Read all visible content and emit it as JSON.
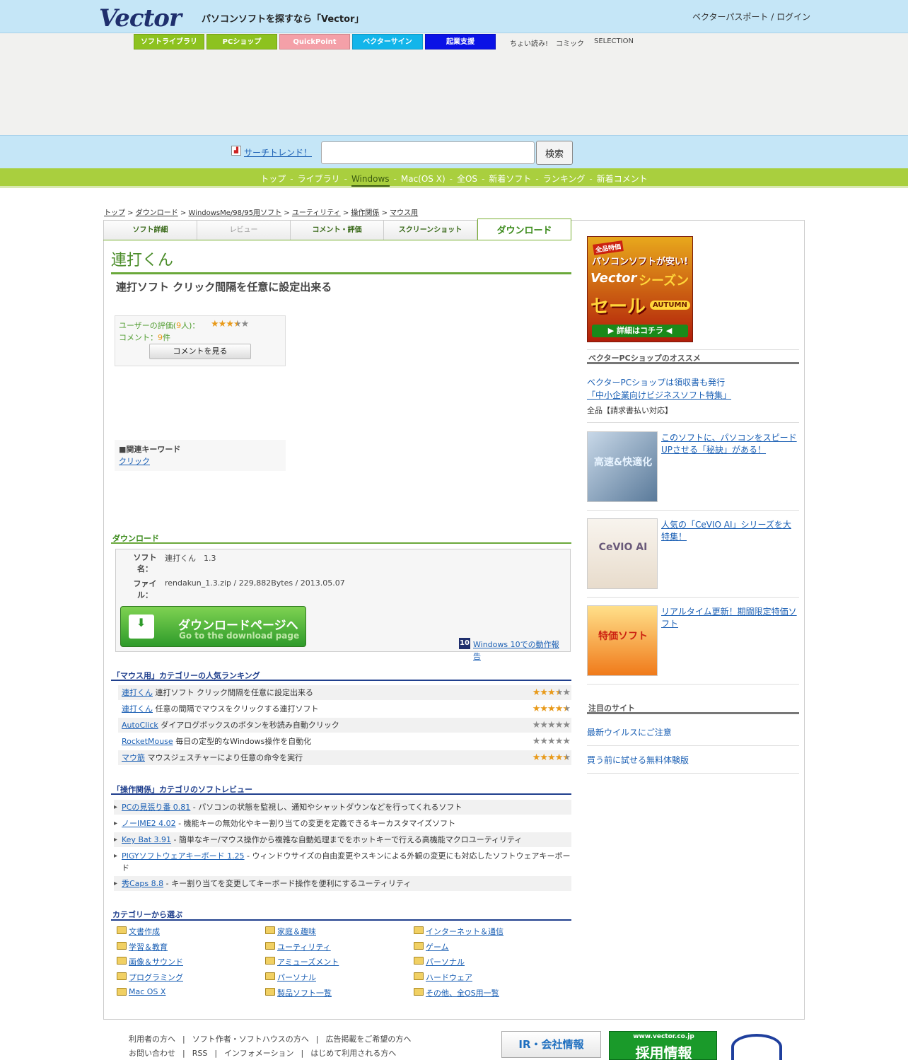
{
  "header": {
    "logo": "Vector",
    "tagline": "パソコンソフトを探すなら「Vector」",
    "login": "ベクターパスポート / ログイン"
  },
  "services": {
    "buttons": [
      {
        "label": "ソフトライブラリ",
        "color": "#8dc21f"
      },
      {
        "label": "PCショップ",
        "color": "#8dc21f"
      },
      {
        "label": "QuickPoint",
        "color": "#f4a0a8"
      },
      {
        "label": "ベクターサイン",
        "color": "#12b5ea"
      },
      {
        "label": "起業支援",
        "color": "#0a12e6"
      }
    ],
    "links": [
      "ちょい読み!",
      "コミック",
      "SELECTION"
    ]
  },
  "search": {
    "trend_label": "サーチトレンド！",
    "placeholder": "",
    "button": "検索"
  },
  "nav": {
    "items": [
      "トップ",
      "ライブラリ",
      "Windows",
      "Mac(OS X)",
      "全OS",
      "新着ソフト",
      "ランキング",
      "新着コメント"
    ],
    "separator": "-",
    "current": "Windows"
  },
  "breadcrumb": [
    "トップ",
    "ダウンロード",
    "WindowsMe/98/95用ソフト",
    "ユーティリティ",
    "操作関係",
    "マウス用"
  ],
  "tabs": [
    "ソフト詳細",
    "レビュー",
    "コメント・評価",
    "スクリーンショット",
    "ダウンロード"
  ],
  "software": {
    "title": "連打くん",
    "description": "連打ソフト クリック間隔を任意に設定出来る",
    "rating_label_pre": "ユーザーの評価(",
    "rating_count": "9",
    "rating_label_post": "人)：",
    "rating": 3.5,
    "comment_label": "コメント：",
    "comment_count": "9",
    "comment_unit": "件",
    "comment_button": "コメントを見る",
    "keyword_heading": "■関連キーワード",
    "keyword": "クリック"
  },
  "download": {
    "heading": "ダウンロード",
    "name_label": "ソフト名：",
    "name_value": "連打くん　1.3",
    "file_label": "ファイル：",
    "file_value": "rendakun_1.3.zip / 229,882Bytes / 2013.05.07",
    "button_main": "ダウンロードページへ",
    "button_sub": "Go to the download page",
    "win10_icon": "10",
    "win10_link": "Windows 10での動作報告"
  },
  "ranking": {
    "heading": "「マウス用」カテゴリーの人気ランキング",
    "items": [
      {
        "name": "連打くん",
        "desc": "連打ソフト クリック間隔を任意に設定出来る",
        "rating": 3.5
      },
      {
        "name": "連打くん",
        "desc": "任意の間隔でマウスをクリックする連打ソフト",
        "rating": 4.5
      },
      {
        "name": "AutoClick",
        "desc": "ダイアログボックスのボタンを秒読み自動クリック",
        "rating": 0
      },
      {
        "name": "RocketMouse",
        "desc": "毎日の定型的なWindows操作を自動化",
        "rating": 0
      },
      {
        "name": "マウ筋",
        "desc": "マウスジェスチャーにより任意の命令を実行",
        "rating": 4.5
      }
    ]
  },
  "reviews": {
    "heading": "「操作関係」カテゴリのソフトレビュー",
    "items": [
      {
        "name": "PCの見張り番 0.81",
        "desc": " - パソコンの状態を監視し、通知やシャットダウンなどを行ってくれるソフト"
      },
      {
        "name": "ノーIME2 4.02",
        "desc": " - 機能キーの無効化やキー割り当ての変更を定義できるキーカスタマイズソフト"
      },
      {
        "name": "Key Bat 3.91",
        "desc": " - 簡単なキー/マウス操作から複雑な自動処理までをホットキーで行える高機能マクロユーティリティ"
      },
      {
        "name": "PIGYソフトウェアキーボード 1.25",
        "desc": " - ウィンドウサイズの自由変更やスキンによる外観の変更にも対応したソフトウェアキーボード"
      },
      {
        "name": "秀Caps 8.8",
        "desc": " - キー割り当てを変更してキーボード操作を便利にするユーティリティ"
      }
    ]
  },
  "categories": {
    "heading": "カテゴリーから選ぶ",
    "items": [
      "文書作成",
      "家庭＆趣味",
      "インターネット＆通信",
      "学習＆教育",
      "ユーティリティ",
      "ゲーム",
      "画像＆サウンド",
      "アミューズメント",
      "パーソナル",
      "プログラミング",
      "パーソナル",
      "ハードウェア",
      "Mac OS X",
      "製品ソフト一覧",
      "その他、全OS用一覧"
    ]
  },
  "sidebar": {
    "sale_banner": {
      "top": "全品特価",
      "line1": "パソコンソフトが安い!",
      "brand": "Vector",
      "line2": "シーズン",
      "line3": "セール",
      "season": "AUTUMN",
      "cta": "▶ 詳細はコチラ ◀"
    },
    "pcshop_heading": "ベクターPCショップのオススメ",
    "pcshop_line1": "ベクターPCショップは領収書も発行",
    "pcshop_link": "「中小企業向けビジネスソフト特集」",
    "pcshop_line2": "全品【請求書払い対応】",
    "promos": [
      {
        "text": "このソフトに、パソコンをスピードUPさせる「秘訣」がある！",
        "thumb": "高速&快適化"
      },
      {
        "text": "人気の「CeVIO AI」シリーズを大特集！",
        "thumb": "CeVIO AI"
      },
      {
        "text": "リアルタイム更新！期間限定特価ソフト",
        "thumb": "特価ソフト"
      }
    ],
    "notice_heading": "注目のサイト",
    "notice_links": [
      "最新ウイルスにご注意",
      "買う前に試せる無料体験版"
    ]
  },
  "footer": {
    "row1": [
      "利用者の方へ",
      "ソフト作者・ソフトハウスの方へ",
      "広告掲載をご希望の方へ"
    ],
    "row2": [
      "お問い合わせ",
      "RSS",
      "インフォメーション",
      "はじめて利用される方へ"
    ],
    "sep": "|",
    "ir_banner": "IR・会社情報",
    "recruit_url": "www.vector.co.jp",
    "recruit_banner": "採用情報"
  }
}
